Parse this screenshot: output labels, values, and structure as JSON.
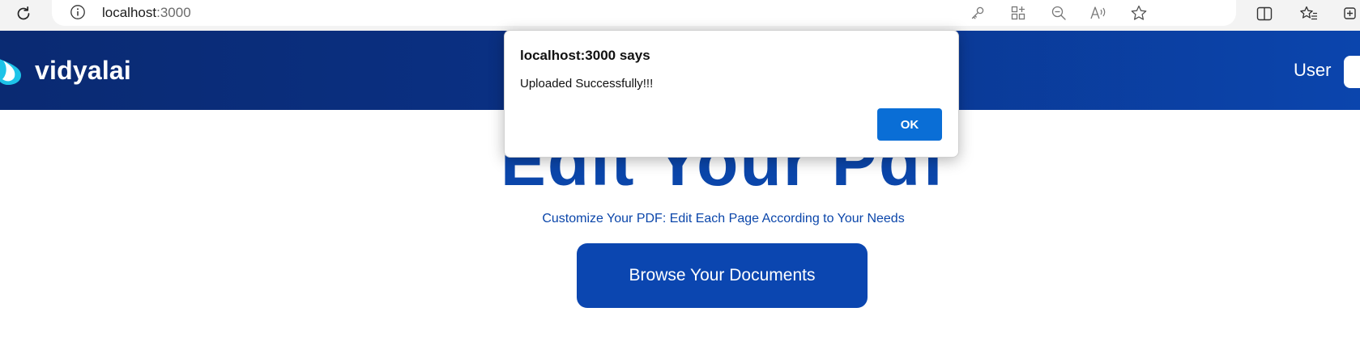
{
  "browser": {
    "url_host": "localhost",
    "url_port": ":3000",
    "icons": {
      "reload": "reload-icon",
      "site_info": "info-icon",
      "password": "key-icon",
      "apps": "app-available-icon",
      "zoom": "zoom-out-icon",
      "read_aloud": "read-aloud-icon",
      "favorite": "star-icon",
      "split_screen": "split-screen-icon",
      "favorites": "favorites-icon",
      "collections": "collections-icon"
    }
  },
  "header": {
    "logo_text": "vidyalai",
    "user_label": "User",
    "colors": {
      "gradient_start": "#0a2a72",
      "gradient_end": "#0b45ad",
      "logo_mark": "#1ec3e8"
    }
  },
  "main": {
    "title": "Edit Your Pdf",
    "subtitle": "Customize Your PDF: Edit Each Page According to Your Needs",
    "browse_button": "Browse Your Documents",
    "accent_color": "#0b46b0"
  },
  "dialog": {
    "title": "localhost:3000 says",
    "message": "Uploaded Successfully!!!",
    "ok_label": "OK",
    "ok_color": "#0a6ed6"
  }
}
